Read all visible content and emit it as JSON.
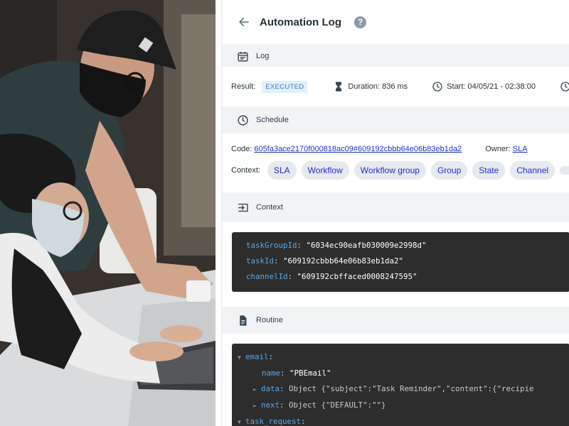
{
  "header": {
    "title": "Automation Log",
    "help_glyph": "?"
  },
  "log": {
    "section_label": "Log",
    "result_label": "Result:",
    "result_badge": "EXECUTED",
    "duration_label": "Duration:",
    "duration_value": "836 ms",
    "start_label": "Start:",
    "start_value": "04/05/21 - 02:38:00"
  },
  "schedule": {
    "section_label": "Schedule",
    "code_label": "Code:",
    "code_value": "605fa3ace2170f000818ac09#609192cbbb64e06b83eb1da2",
    "owner_label": "Owner:",
    "owner_value": "SLA",
    "context_label": "Context:",
    "chips": [
      "SLA",
      "Workflow",
      "Workflow group",
      "Group",
      "State",
      "Channel"
    ]
  },
  "context": {
    "section_label": "Context",
    "lines": [
      {
        "key": "taskGroupId",
        "sep": ":",
        "value": "\"6034ec90eafb030009e2998d\""
      },
      {
        "key": "taskId",
        "sep": ":",
        "value": "\"609192cbbb64e06b83eb1da2\""
      },
      {
        "key": "channelId",
        "sep": ":",
        "value": "\"609192cbffaced0008247595\""
      }
    ]
  },
  "routine": {
    "section_label": "Routine",
    "email_key": "email",
    "name_key": "name",
    "name_value": "\"PBEmail\"",
    "data_key": "data",
    "data_value": "Object {\"subject\":\"Task Reminder\",\"content\":{\"recipie",
    "next_key": "next",
    "next_value": "Object {\"DEFAULT\":\"\"}",
    "task_request_key": "task_request",
    "colon": ":"
  },
  "icons": {
    "back": "arrow-left-icon",
    "help": "help-circle-icon",
    "log": "calendar-icon",
    "duration": "hourglass-icon",
    "start": "clock-icon",
    "schedule": "clock-icon",
    "context": "input-arrow-icon",
    "routine": "document-icon"
  },
  "colors": {
    "link": "#1e35c9",
    "badge_bg": "#e1f0fb",
    "badge_text": "#3b7dc4",
    "chip_bg": "#e6e9ee",
    "code_bg": "#2d2d2d",
    "code_key": "#5aa6e8"
  }
}
